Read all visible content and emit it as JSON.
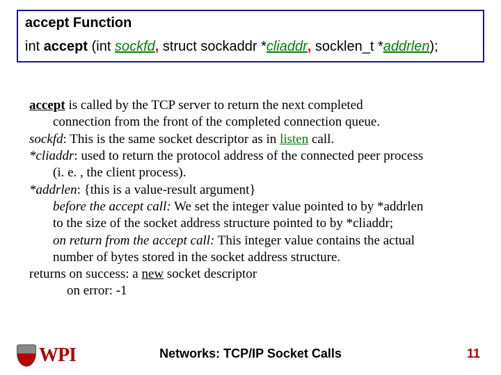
{
  "proto": {
    "title_fn": "accept",
    "title_word": "  Function",
    "ret": "int  ",
    "name": "accept",
    "open": "  (int  ",
    "a1": "sockfd",
    "mid1": " struct sockaddr  *",
    "a2": "cliaddr",
    "mid2": " socklen_t *",
    "a3": "addrlen",
    "close": ");"
  },
  "body": {
    "l1a": "accept",
    "l1b": "  is called  by the TCP server to return the next completed",
    "l2": "connection from the front of the completed connection queue.",
    "l3a": "sockfd",
    "l3b": ":    This is the same socket descriptor as in ",
    "l3c": "listen",
    "l3d": " call.",
    "l4a": "*cliaddr",
    "l4b": ": used to return the protocol address of the connected peer process",
    "l5": "(i. e. , the client process).",
    "l6a": "*addrlen",
    "l6b": ": {this is a value-result argument}",
    "l7a": "before the accept call:",
    "l7b": " We set the integer value pointed to by *addrlen",
    "l8": "to the size of the socket address structure pointed to by *cliaddr;",
    "l9a": "on return from the accept call:",
    "l9b": " This integer value contains the actual",
    "l10": "number of bytes stored in the socket address structure.",
    "l11a": "returns",
    "l11b": "  on success: a ",
    "l11c": "new",
    "l11d": " socket descriptor",
    "l12": "on error:     -1"
  },
  "footer": {
    "title": "Networks: TCP/IP Socket Calls",
    "page": "11",
    "logo_text": "WPI"
  }
}
